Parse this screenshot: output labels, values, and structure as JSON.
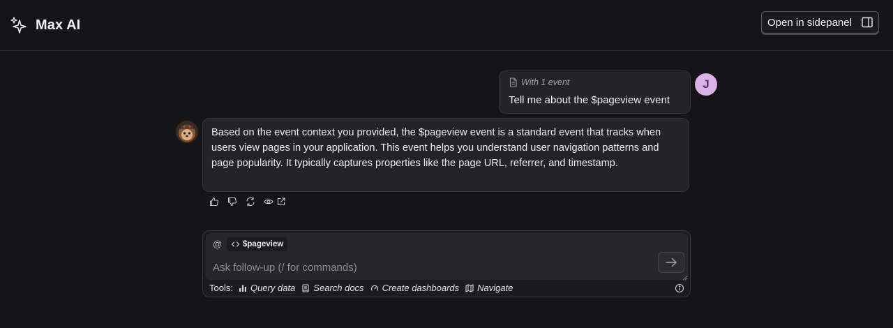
{
  "header": {
    "title": "Max AI",
    "sidepanel_button": "Open in sidepanel"
  },
  "user_message": {
    "context_label": "With 1 event",
    "text": "Tell me about the $pageview event",
    "avatar_initial": "J"
  },
  "assistant_message": {
    "text": "Based on the event context you provided, the $pageview event is a standard event that tracks when users view pages in your application. This event helps you understand user navigation patterns and page popularity. It typically captures properties like the page URL, referrer, and timestamp.",
    "actions": [
      "thumbs-up-icon",
      "thumbs-down-icon",
      "retry-icon",
      "eye-icon",
      "external-link-icon"
    ]
  },
  "composer": {
    "mention_symbol": "@",
    "context_chip": "$pageview",
    "placeholder": "Ask follow-up (/ for commands)",
    "value": "",
    "tools_label": "Tools:",
    "tools": [
      {
        "label": "Query data",
        "icon": "bar-chart-icon"
      },
      {
        "label": "Search docs",
        "icon": "book-icon"
      },
      {
        "label": "Create dashboards",
        "icon": "dashboard-icon"
      },
      {
        "label": "Navigate",
        "icon": "map-icon"
      }
    ]
  },
  "colors": {
    "background": "#151518",
    "bubble": "#232328",
    "user_avatar_bg": "#d9b2e8",
    "text": "#eeeef0"
  }
}
